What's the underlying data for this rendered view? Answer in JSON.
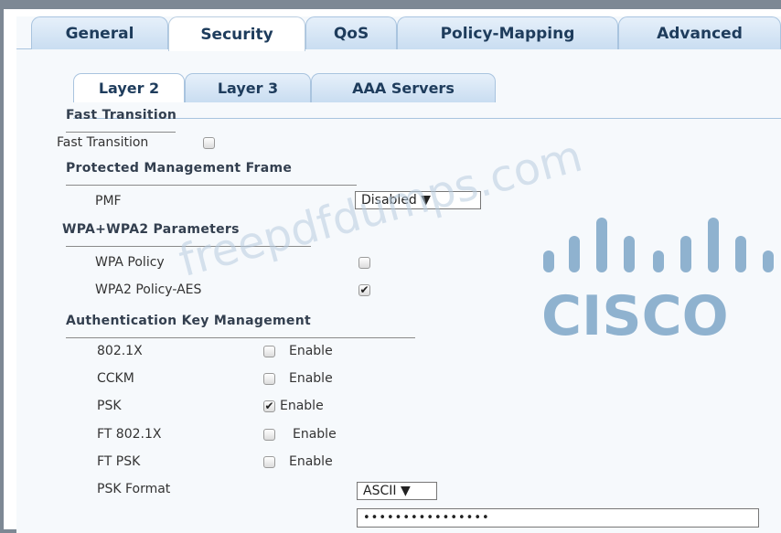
{
  "tabs": [
    {
      "label": "General"
    },
    {
      "label": "Security"
    },
    {
      "label": "QoS"
    },
    {
      "label": "Policy-Mapping"
    },
    {
      "label": "Advanced"
    }
  ],
  "subtabs": [
    {
      "label": "Layer 2"
    },
    {
      "label": "Layer 3"
    },
    {
      "label": "AAA Servers"
    }
  ],
  "fast_transition": {
    "heading": "Fast Transition",
    "label": "Fast Transition",
    "checked": false
  },
  "pmf": {
    "heading": "Protected Management Frame",
    "label": "PMF",
    "value": "Disabled"
  },
  "wpa": {
    "heading": "WPA+WPA2 Parameters",
    "wpa_policy_label": "WPA Policy",
    "wpa_policy_checked": false,
    "wpa2_aes_label": "WPA2 Policy-AES",
    "wpa2_aes_checked": true
  },
  "akm": {
    "heading": "Authentication Key Management",
    "enable_label": "Enable",
    "items": [
      {
        "label": "802.1X",
        "checked": false
      },
      {
        "label": "CCKM",
        "checked": false
      },
      {
        "label": "PSK",
        "checked": true
      },
      {
        "label": "FT 802.1X",
        "checked": false
      },
      {
        "label": "FT PSK",
        "checked": false
      }
    ],
    "psk_format_label": "PSK Format",
    "psk_format_value": "ASCII",
    "psk_value": "••••••••••••••••"
  },
  "logo_text": "CISCO",
  "watermark": "freepdfdumps.com",
  "colors": {
    "tab_border": "#a9c4df",
    "heading_text": "#333f4f",
    "logo": "#8fb2cf"
  }
}
